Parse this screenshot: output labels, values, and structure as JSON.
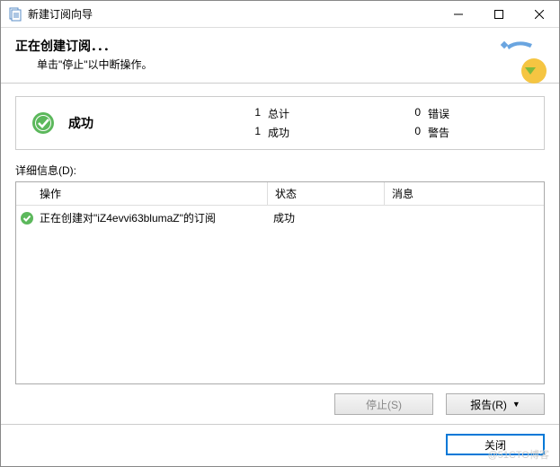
{
  "window": {
    "title": "新建订阅向导"
  },
  "header": {
    "title": "正在创建订阅．．．",
    "subtitle": "单击\"停止\"以中断操作。"
  },
  "status": {
    "label": "成功",
    "stats": {
      "total_num": "1",
      "total_lbl": "总计",
      "success_num": "1",
      "success_lbl": "成功",
      "error_num": "0",
      "error_lbl": "错误",
      "warn_num": "0",
      "warn_lbl": "警告"
    }
  },
  "details": {
    "label": "详细信息(D):",
    "columns": {
      "op": "操作",
      "status": "状态",
      "msg": "消息"
    },
    "rows": [
      {
        "op": "正在创建对\"iZ4evvi63blumaZ\"的订阅",
        "status": "成功",
        "msg": ""
      }
    ]
  },
  "actions": {
    "stop": "停止(S)",
    "report": "报告(R)"
  },
  "footer": {
    "close": "关闭"
  },
  "watermark": "@51CTO博客"
}
